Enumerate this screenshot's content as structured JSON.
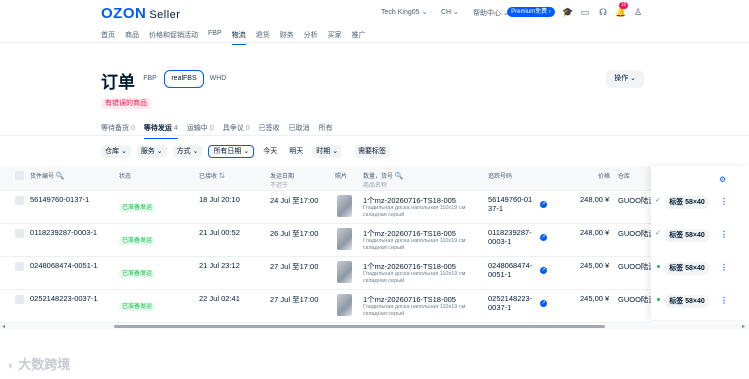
{
  "header": {
    "logo": "OZON",
    "logo_sub": "Seller",
    "store": "Tech King05 ⌄",
    "lang": "CH ⌄",
    "help": "帮助中心 ⌄",
    "premium": "Premium免费 ›",
    "notif_count": "16"
  },
  "nav": [
    "首页",
    "商品",
    "价格和促销活动",
    "FBP",
    "物流",
    "退货",
    "财务",
    "分析",
    "买家",
    "推广"
  ],
  "page": {
    "title": "订单",
    "segments": [
      "FBP",
      "realFBS",
      "WHD"
    ],
    "ops": "操作 ⌄",
    "error": "有错误的商品"
  },
  "tabs": [
    {
      "label": "等待备货",
      "count": "0"
    },
    {
      "label": "等待发运",
      "count": "4"
    },
    {
      "label": "运输中",
      "count": "0"
    },
    {
      "label": "具争议",
      "count": "0"
    },
    {
      "label": "已签收",
      "count": ""
    },
    {
      "label": "已取消",
      "count": ""
    },
    {
      "label": "所有",
      "count": ""
    }
  ],
  "filters": [
    "仓库 ⌄",
    "服务 ⌄",
    "方式 ⌄",
    "所有日期 ⌄",
    "今天",
    "明天",
    "时期 ⌄",
    "需要标签"
  ],
  "columns": {
    "id": "货件编号",
    "status": "状态",
    "accepted": "已接收",
    "ship_date": "发运日期",
    "ship_date_sub": "不迟于",
    "photo": "照片",
    "qty": "数量，货号",
    "qty_sub": "商品名称",
    "tracking": "追踪号码",
    "price": "价格",
    "warehouse": "仓库"
  },
  "rows": [
    {
      "id": "56149760-0137-1",
      "status": "已准备发运",
      "accepted": "18 Jul 20:10",
      "ship": "24 Jul 至17:00",
      "sku": "1个mz-20260716-TS18-005",
      "name1": "Гладильная доска напольная 110х19 см",
      "name2": "складная серый",
      "track1": "56149760-01",
      "track2": "37-1",
      "price": "248,00 ¥",
      "wh": "GUOO陆运",
      "label": "标签 58×40"
    },
    {
      "id": "0118239287-0003-1",
      "status": "已准备发运",
      "accepted": "21 Jul 00:52",
      "ship": "26 Jul 至17:00",
      "sku": "1个mz-20260716-TS18-005",
      "name1": "Гладильная доска напольная 110х19 см",
      "name2": "складная серый",
      "track1": "0118239287-",
      "track2": "0003-1",
      "price": "248,00 ¥",
      "wh": "GUOO陆运",
      "label": "标签 58×40"
    },
    {
      "id": "0248068474-0051-1",
      "status": "已准备发运",
      "accepted": "21 Jul 23:12",
      "ship": "27 Jul 至17:00",
      "sku": "1个mz-20260716-TS18-005",
      "name1": "Гладильная доска напольная 110х19 см",
      "name2": "складная серый",
      "track1": "0248068474-",
      "track2": "0051-1",
      "price": "245,00 ¥",
      "wh": "GUOO陆运",
      "label": "标签 58×40"
    },
    {
      "id": "0252148223-0037-1",
      "status": "已准备发运",
      "accepted": "22 Jul 02:41",
      "ship": "27 Jul 至17:00",
      "sku": "1个mz-20260716-TS18-005",
      "name1": "Гладильная доска напольная 110х19 см",
      "name2": "складная серый",
      "track1": "0252148223-",
      "track2": "0037-1",
      "price": "245,00 ¥",
      "wh": "GUOO陆运",
      "label": "标签 58×40"
    }
  ],
  "watermark": "大数跨境",
  "colors": {
    "accent": "#005bff",
    "success": "#10c44c",
    "error": "#f91155"
  }
}
